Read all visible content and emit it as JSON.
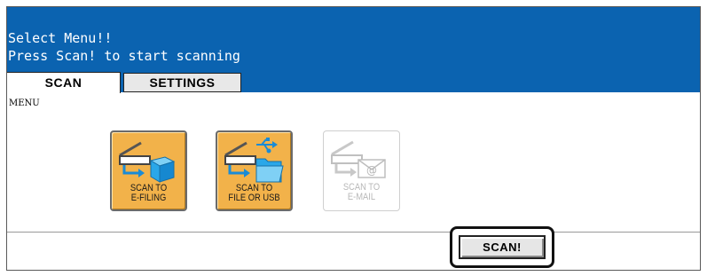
{
  "header": {
    "line1": "Select Menu!!",
    "line2": "Press Scan! to start scanning"
  },
  "tabs": [
    {
      "label": "SCAN",
      "active": true
    },
    {
      "label": "SETTINGS",
      "active": false
    }
  ],
  "menu_label": "MENU",
  "functions": [
    {
      "label": "SCAN TO\nE-FILING",
      "icon": "scan-to-efiling-icon",
      "enabled": true
    },
    {
      "label": "SCAN TO\nFILE OR USB",
      "icon": "scan-to-file-usb-icon",
      "enabled": true
    },
    {
      "label": "SCAN TO\nE-MAIL",
      "icon": "scan-to-email-icon",
      "enabled": false
    }
  ],
  "action": {
    "scan_label": "SCAN!"
  },
  "colors": {
    "header_bg": "#0b63b0",
    "button_active": "#f2b24a",
    "arrow_blue": "#1a8bd6",
    "folder_blue": "#2aa7e8"
  }
}
